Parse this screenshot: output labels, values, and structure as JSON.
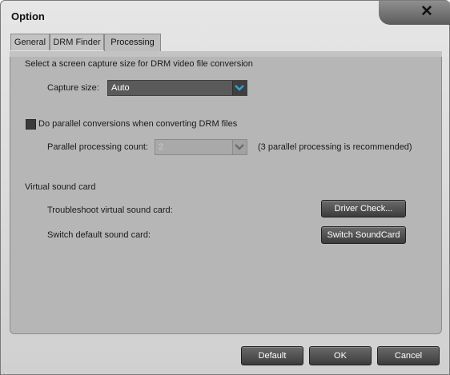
{
  "window": {
    "title": "Option"
  },
  "tabs": [
    {
      "label": "General"
    },
    {
      "label": "DRM Finder"
    },
    {
      "label": "Processing"
    }
  ],
  "processing": {
    "capture_heading": "Select a screen capture size for DRM video file conversion",
    "capture_label": "Capture size:",
    "capture_value": "Auto",
    "parallel_checkbox_label": "Do parallel conversions when converting DRM files",
    "parallel_checked": true,
    "parallel_count_label": "Parallel processing count:",
    "parallel_count_value": "2",
    "parallel_hint": "(3 parallel processing is recommended)",
    "sound_heading": "Virtual sound card",
    "troubleshoot_label": "Troubleshoot virtual sound card:",
    "driver_check_button": "Driver Check...",
    "switch_label": "Switch default sound card:",
    "switch_button": "Switch SoundCard"
  },
  "footer": {
    "default_button": "Default",
    "ok_button": "OK",
    "cancel_button": "Cancel"
  },
  "colors": {
    "arrow_active": "#2aa3d6",
    "arrow_disabled": "#6e6e6e"
  }
}
